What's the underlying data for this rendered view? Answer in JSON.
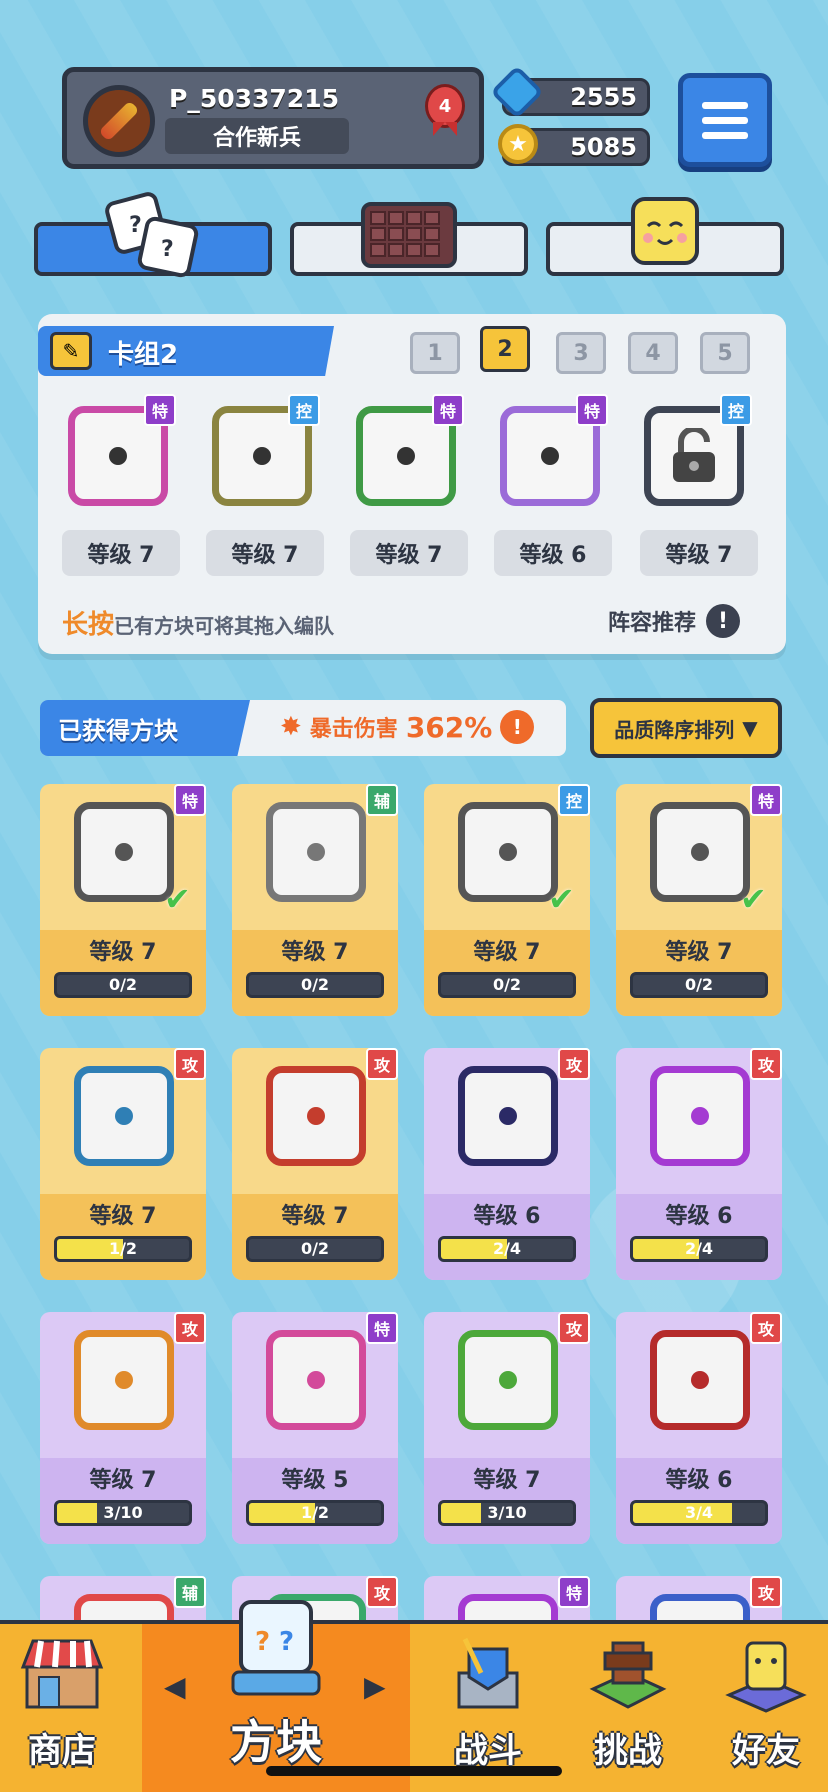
{
  "header": {
    "player_name": "P_50337215",
    "player_title": "合作新兵",
    "rank": "4",
    "gems": "2555",
    "coins": "5085",
    "icons": {
      "avatar": "scroll-avatar-icon",
      "gem": "gem-icon",
      "coin": "coin-icon",
      "menu": "menu-icon",
      "rank": "rank-ribbon-icon"
    }
  },
  "top_tabs": [
    {
      "icon": "dice-icon",
      "active": true
    },
    {
      "icon": "chocolate-board-icon",
      "active": false
    },
    {
      "icon": "smiley-cube-icon",
      "active": false
    }
  ],
  "deck": {
    "name": "卡组2",
    "tabs": [
      "1",
      "2",
      "3",
      "4",
      "5"
    ],
    "active_tab": "2",
    "slots": [
      {
        "type": "特",
        "level": "等级 7",
        "color": "#c94aa6",
        "type_color": "#8e3ec9"
      },
      {
        "type": "控",
        "level": "等级 7",
        "color": "#8a8440",
        "type_color": "#3b9be6"
      },
      {
        "type": "特",
        "level": "等级 7",
        "color": "#3f9a45",
        "type_color": "#8e3ec9"
      },
      {
        "type": "特",
        "level": "等级 6",
        "color": "#9b6bd8",
        "type_color": "#8e3ec9"
      },
      {
        "type": "控",
        "level": "等级 7",
        "color": "#3d4453",
        "type_color": "#3b9be6"
      }
    ],
    "hint_highlight": "长按",
    "hint_rest": "已有方块可将其拖入编队",
    "recommend": "阵容推荐",
    "recommend_icon": "!"
  },
  "owned": {
    "title": "已获得方块",
    "crit_label": "暴击伤害",
    "crit_value": "362%",
    "crit_icon": "!",
    "sort_label": "品质降序排列",
    "sort_icon": "▼"
  },
  "cards": [
    {
      "type": "特",
      "level": "等级 7",
      "progress": "0/2",
      "fill": 0,
      "theme": "gold",
      "color": "#555",
      "type_color": "#8e3ec9",
      "checked": true
    },
    {
      "type": "辅",
      "level": "等级 7",
      "progress": "0/2",
      "fill": 0,
      "theme": "gold",
      "color": "#777",
      "type_color": "#3aa86b",
      "checked": false
    },
    {
      "type": "控",
      "level": "等级 7",
      "progress": "0/2",
      "fill": 0,
      "theme": "gold",
      "color": "#555",
      "type_color": "#3b9be6",
      "checked": true
    },
    {
      "type": "特",
      "level": "等级 7",
      "progress": "0/2",
      "fill": 0,
      "theme": "gold",
      "color": "#555",
      "type_color": "#8e3ec9",
      "checked": true
    },
    {
      "type": "攻",
      "level": "等级 7",
      "progress": "1/2",
      "fill": 0.5,
      "theme": "gold",
      "color": "#2f7fb5",
      "type_color": "#e04848",
      "checked": false
    },
    {
      "type": "攻",
      "level": "等级 7",
      "progress": "0/2",
      "fill": 0,
      "theme": "gold",
      "color": "#c43d2d",
      "type_color": "#e04848",
      "checked": false
    },
    {
      "type": "攻",
      "level": "等级 6",
      "progress": "2/4",
      "fill": 0.5,
      "theme": "purple",
      "color": "#2b2a66",
      "type_color": "#e04848",
      "checked": false
    },
    {
      "type": "攻",
      "level": "等级 6",
      "progress": "2/4",
      "fill": 0.5,
      "theme": "purple",
      "color": "#a43ad2",
      "type_color": "#e04848",
      "checked": false
    },
    {
      "type": "攻",
      "level": "等级 7",
      "progress": "3/10",
      "fill": 0.3,
      "theme": "purple",
      "color": "#e08a2a",
      "type_color": "#e04848",
      "checked": false
    },
    {
      "type": "特",
      "level": "等级 5",
      "progress": "1/2",
      "fill": 0.5,
      "theme": "purple",
      "color": "#d34a9a",
      "type_color": "#8e3ec9",
      "checked": false
    },
    {
      "type": "攻",
      "level": "等级 7",
      "progress": "3/10",
      "fill": 0.3,
      "theme": "purple",
      "color": "#4ca83a",
      "type_color": "#e04848",
      "checked": false
    },
    {
      "type": "攻",
      "level": "等级 6",
      "progress": "3/4",
      "fill": 0.75,
      "theme": "purple",
      "color": "#b52b2b",
      "type_color": "#e04848",
      "checked": false
    }
  ],
  "partial_cards": [
    {
      "type": "辅",
      "type_color": "#3aa86b",
      "color": "#e04848"
    },
    {
      "type": "攻",
      "type_color": "#e04848",
      "color": "#3aa86b"
    },
    {
      "type": "特",
      "type_color": "#8e3ec9",
      "color": "#a43ad2"
    },
    {
      "type": "攻",
      "type_color": "#e04848",
      "color": "#3b5fc9"
    }
  ],
  "bottom_nav": [
    {
      "label": "商店",
      "icon": "shop-icon",
      "active": false
    },
    {
      "label": "方块",
      "icon": "dice-block-icon",
      "active": true
    },
    {
      "label": "战斗",
      "icon": "battle-icon",
      "active": false
    },
    {
      "label": "挑战",
      "icon": "challenge-icon",
      "active": false
    },
    {
      "label": "好友",
      "icon": "friends-icon",
      "active": false
    }
  ],
  "nav_arrows": {
    "left": "◀",
    "right": "▶"
  }
}
